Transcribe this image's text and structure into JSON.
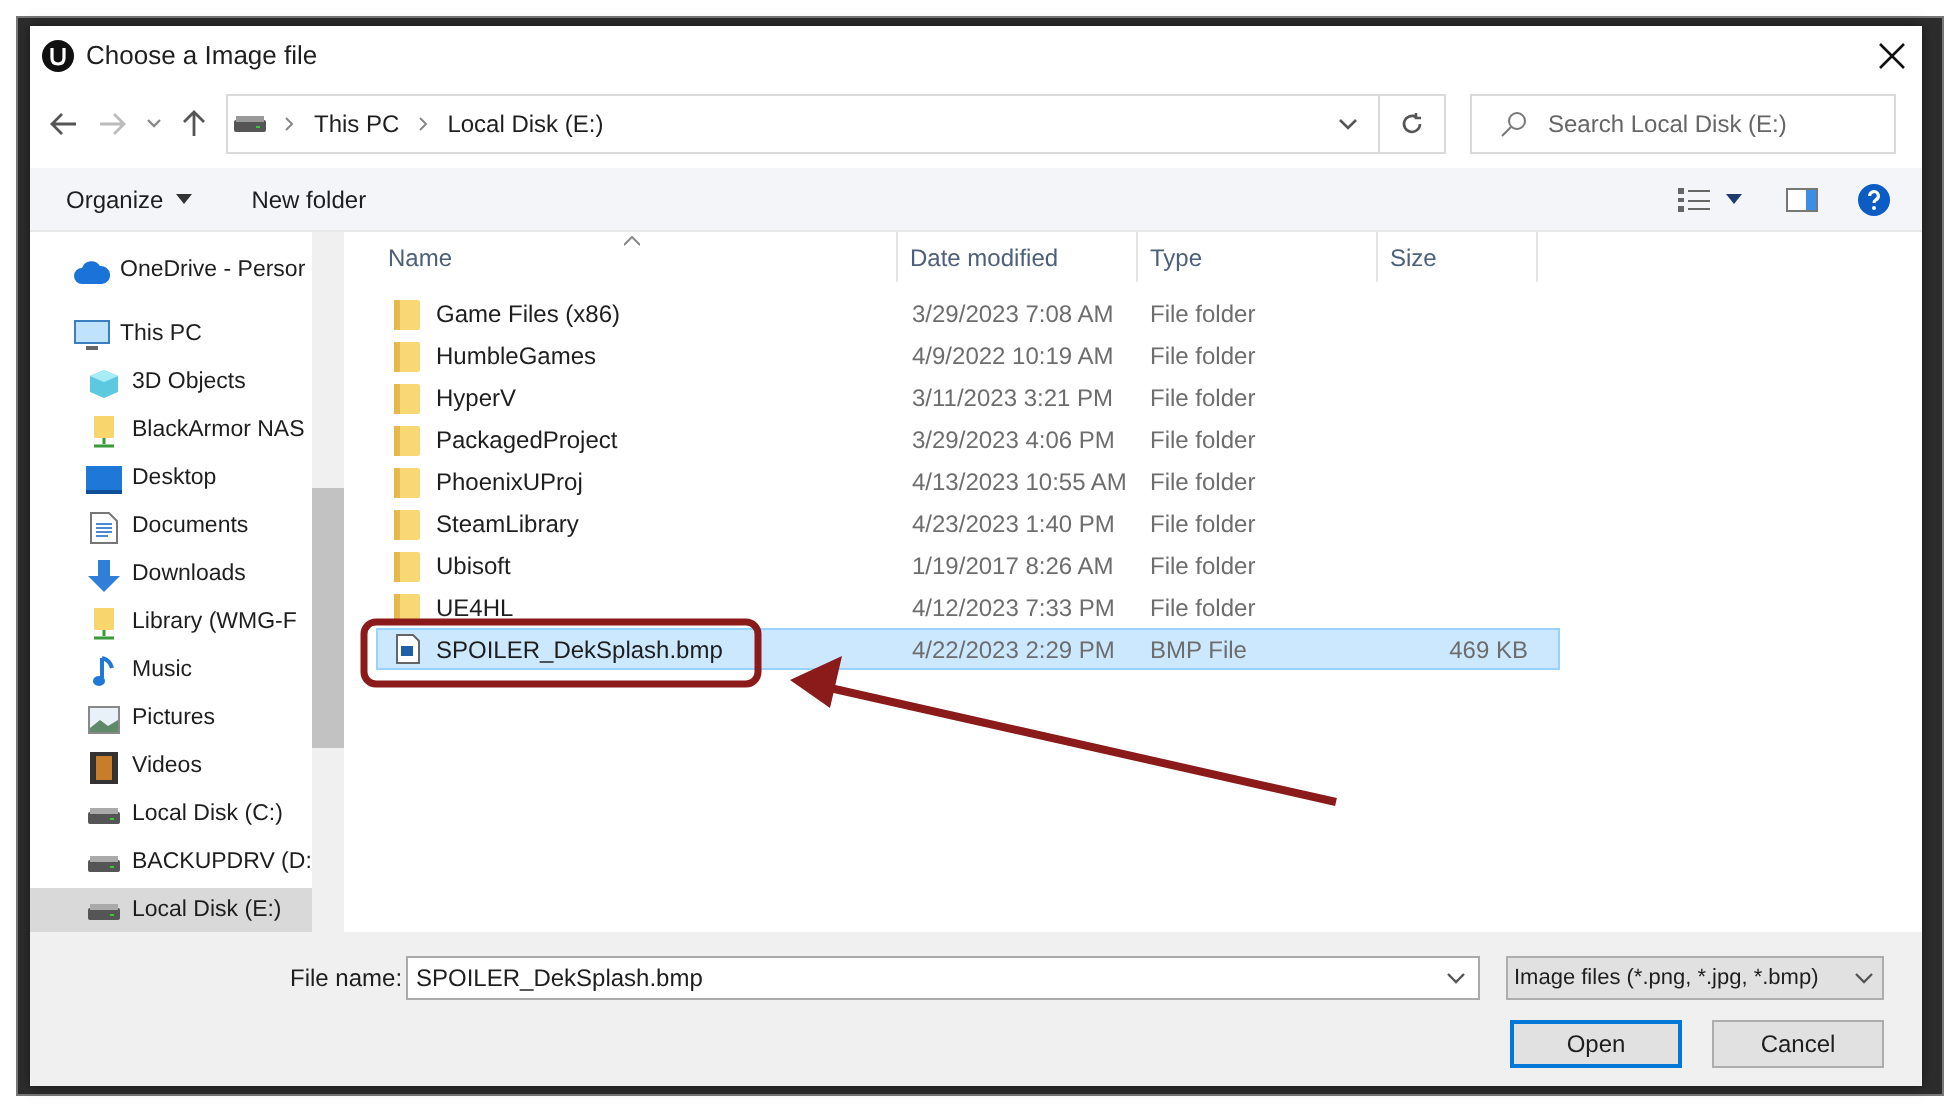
{
  "window": {
    "title": "Choose a Image file"
  },
  "address": {
    "crumbs": [
      "This PC",
      "Local Disk (E:)"
    ]
  },
  "search": {
    "placeholder": "Search Local Disk (E:)"
  },
  "toolbar": {
    "organize": "Organize",
    "new_folder": "New folder"
  },
  "sidebar": {
    "items": [
      {
        "label": "OneDrive - Persor",
        "kind": "cloud",
        "selected": false
      },
      {
        "label": "This PC",
        "kind": "computer",
        "selected": false,
        "children": [
          {
            "label": "3D Objects",
            "kind": "cube",
            "selected": false
          },
          {
            "label": "BlackArmor NAS",
            "kind": "network",
            "selected": false
          },
          {
            "label": "Desktop",
            "kind": "desktop",
            "selected": false
          },
          {
            "label": "Documents",
            "kind": "documents",
            "selected": false
          },
          {
            "label": "Downloads",
            "kind": "downloads",
            "selected": false
          },
          {
            "label": "Library (WMG-F",
            "kind": "network",
            "selected": false
          },
          {
            "label": "Music",
            "kind": "music",
            "selected": false
          },
          {
            "label": "Pictures",
            "kind": "pictures",
            "selected": false
          },
          {
            "label": "Videos",
            "kind": "videos",
            "selected": false
          },
          {
            "label": "Local Disk (C:)",
            "kind": "drive",
            "selected": false
          },
          {
            "label": "BACKUPDRV (D:",
            "kind": "drive",
            "selected": false
          },
          {
            "label": "Local Disk (E:)",
            "kind": "drive",
            "selected": true
          }
        ]
      }
    ]
  },
  "table": {
    "columns": [
      "Name",
      "Date modified",
      "Type",
      "Size"
    ],
    "rows": [
      {
        "kind": "folder",
        "name": "Game Files (x86)",
        "date": "3/29/2023 7:08 AM",
        "type": "File folder",
        "selected": false
      },
      {
        "kind": "folder",
        "name": "HumbleGames",
        "date": "4/9/2022 10:19 AM",
        "type": "File folder",
        "selected": false
      },
      {
        "kind": "folder",
        "name": "HyperV",
        "date": "3/11/2023 3:21 PM",
        "type": "File folder",
        "selected": false
      },
      {
        "kind": "folder",
        "name": "PackagedProject",
        "date": "3/29/2023 4:06 PM",
        "type": "File folder",
        "selected": false
      },
      {
        "kind": "folder",
        "name": "PhoenixUProj",
        "date": "4/13/2023 10:55 AM",
        "type": "File folder",
        "selected": false
      },
      {
        "kind": "folder",
        "name": "SteamLibrary",
        "date": "4/23/2023 1:40 PM",
        "type": "File folder",
        "selected": false
      },
      {
        "kind": "folder",
        "name": "Ubisoft",
        "date": "1/19/2017 8:26 AM",
        "type": "File folder",
        "selected": false
      },
      {
        "kind": "folder",
        "name": "UE4HL",
        "date": "4/12/2023 7:33 PM",
        "type": "File folder",
        "selected": false
      },
      {
        "kind": "image",
        "name": "SPOILER_DekSplash.bmp",
        "date": "4/22/2023 2:29 PM",
        "type": "BMP File",
        "size": "469 KB",
        "selected": true
      }
    ]
  },
  "file_name": {
    "label": "File name:",
    "value": "SPOILER_DekSplash.bmp"
  },
  "file_type": {
    "value": "Image files (*.png, *.jpg, *.bmp)"
  },
  "buttons": [
    "Open",
    "Cancel"
  ]
}
